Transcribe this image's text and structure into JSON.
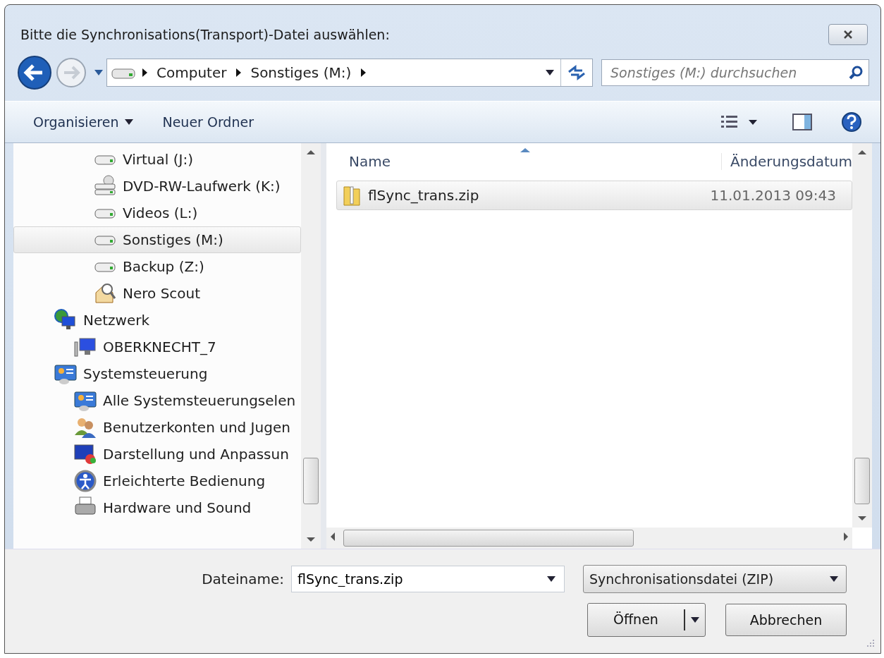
{
  "window": {
    "title": "Bitte die Synchronisations(Transport)-Datei auswählen:"
  },
  "nav": {
    "breadcrumb": [
      "Computer",
      "Sonstiges (M:)"
    ],
    "search": {
      "placeholder": "Sonstiges (M:) durchsuchen"
    }
  },
  "toolbar": {
    "organize": "Organisieren",
    "new_folder": "Neuer Ordner"
  },
  "sidebar": {
    "tree": [
      {
        "children": [
          {
            "label": "Virtual (J:)",
            "kind": "drive",
            "selected": false
          },
          {
            "label": "DVD-RW-Laufwerk (K:)",
            "kind": "dvd",
            "selected": false
          },
          {
            "label": "Videos (L:)",
            "kind": "drive",
            "selected": false
          },
          {
            "label": "Sonstiges (M:)",
            "kind": "drive",
            "selected": true
          },
          {
            "label": "Backup (Z:)",
            "kind": "drive",
            "selected": false
          },
          {
            "label": "Nero Scout",
            "kind": "scout",
            "selected": false
          }
        ]
      },
      {
        "label": "Netzwerk",
        "kind": "network",
        "selected": false,
        "children": [
          {
            "label": "OBERKNECHT_7",
            "kind": "computer",
            "selected": false
          }
        ]
      },
      {
        "label": "Systemsteuerung",
        "kind": "control",
        "selected": false,
        "children": [
          {
            "label": "Alle Systemsteuerungselen",
            "kind": "control",
            "selected": false
          },
          {
            "label": "Benutzerkonten und Jugen",
            "kind": "users",
            "selected": false
          },
          {
            "label": "Darstellung und Anpassun",
            "kind": "display",
            "selected": false
          },
          {
            "label": "Erleichterte Bedienung",
            "kind": "access",
            "selected": false
          },
          {
            "label": "Hardware und Sound",
            "kind": "printer",
            "selected": false
          }
        ]
      }
    ]
  },
  "files": {
    "columns": [
      "Name",
      "Änderungsdatum"
    ],
    "rows": [
      {
        "name": "flSync_trans.zip",
        "date": "11.01.2013 09:43",
        "selected": true
      }
    ]
  },
  "footer": {
    "filename_label": "Dateiname:",
    "filename": "flSync_trans.zip",
    "filter": "Synchronisationsdatei (ZIP)",
    "open": "Öffnen",
    "cancel": "Abbrechen"
  }
}
